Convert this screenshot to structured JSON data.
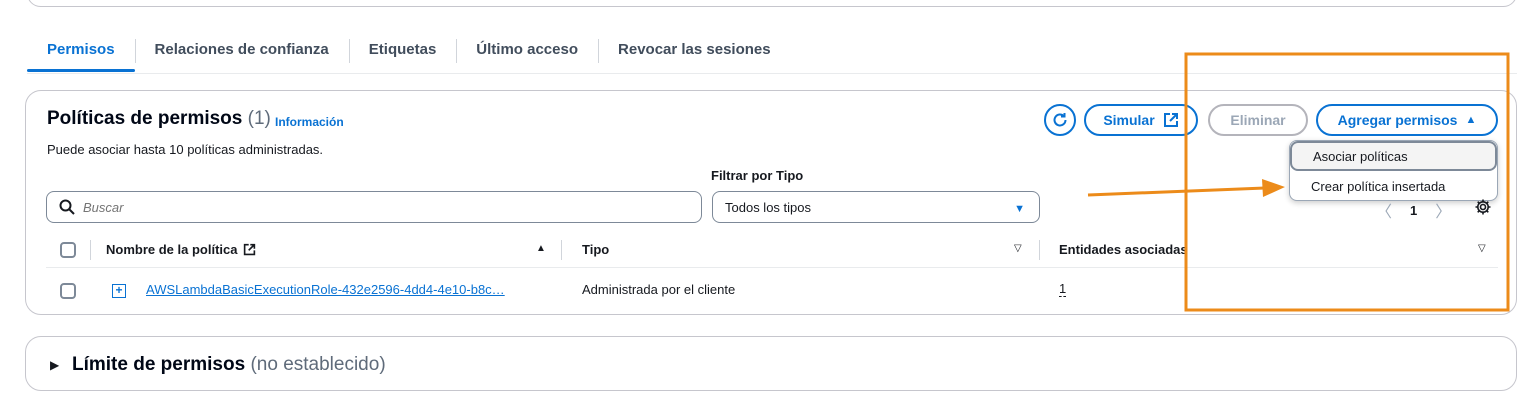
{
  "tabs": [
    {
      "label": "Permisos",
      "active": true
    },
    {
      "label": "Relaciones de confianza",
      "active": false
    },
    {
      "label": "Etiquetas",
      "active": false
    },
    {
      "label": "Último acceso",
      "active": false
    },
    {
      "label": "Revocar las sesiones",
      "active": false
    }
  ],
  "policies": {
    "title": "Políticas de permisos",
    "count": "(1)",
    "info_link": "Información",
    "description": "Puede asociar hasta 10 políticas administradas.",
    "buttons": {
      "simulate": "Simular",
      "delete": "Eliminar",
      "add_permissions": "Agregar permisos"
    },
    "dropdown": {
      "items": [
        "Asociar políticas",
        "Crear política insertada"
      ]
    },
    "filter_label": "Filtrar por Tipo",
    "search_placeholder": "Buscar",
    "type_filter_value": "Todos los tipos",
    "pagination": {
      "current_page": "1"
    },
    "columns": {
      "name": "Nombre de la política",
      "type": "Tipo",
      "entities": "Entidades asociadas"
    },
    "rows": [
      {
        "name": "AWSLambdaBasicExecutionRole-432e2596-4dd4-4e10-b8c…",
        "type": "Administrada por el cliente",
        "entities": "1"
      }
    ]
  },
  "boundary": {
    "title": "Límite de permisos",
    "status": "(no establecido)"
  },
  "annotation": {
    "highlight_color": "#ec8b1a"
  },
  "colors": {
    "accent": "#0972d3",
    "disabled": "#9ba7b6"
  }
}
